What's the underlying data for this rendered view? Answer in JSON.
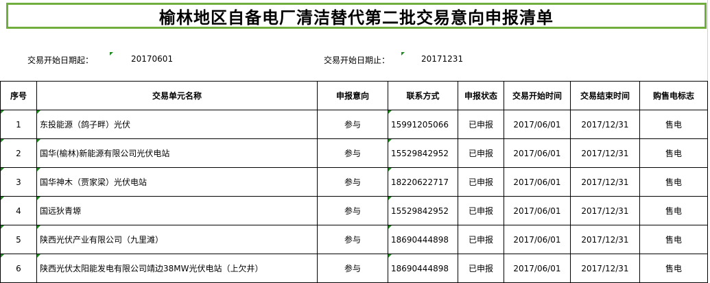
{
  "title": "榆林地区自备电厂清洁替代第二批交易意向申报清单",
  "meta": {
    "start_label": "交易开始日期起：",
    "start_value": "20170601",
    "end_label": "交易开始日期止：",
    "end_value": "20171231"
  },
  "table": {
    "headers": [
      "序号",
      "交易单元名称",
      "申报意向",
      "联系方式",
      "申报状态",
      "交易开始时间",
      "交易结束时间",
      "购售电标志"
    ],
    "rows": [
      {
        "no": "1",
        "name": "东投能源（鸽子畔）光伏",
        "intent": "参与",
        "phone": "15991205066",
        "status": "已申报",
        "start": "2017/06/01",
        "end": "2017/12/31",
        "flag": "售电"
      },
      {
        "no": "2",
        "name": "国华(榆林)新能源有限公司光伏电站",
        "intent": "参与",
        "phone": "15529842952",
        "status": "已申报",
        "start": "2017/06/01",
        "end": "2017/12/31",
        "flag": "售电"
      },
      {
        "no": "3",
        "name": "国华神木（贾家梁）光伏电站",
        "intent": "参与",
        "phone": "18220622717",
        "status": "已申报",
        "start": "2017/06/01",
        "end": "2017/12/31",
        "flag": "售电"
      },
      {
        "no": "4",
        "name": "国远狄青塬",
        "intent": "参与",
        "phone": "15529842952",
        "status": "已申报",
        "start": "2017/06/01",
        "end": "2017/12/31",
        "flag": "售电"
      },
      {
        "no": "5",
        "name": "陕西光伏产业有限公司（九里滩）",
        "intent": "参与",
        "phone": "18690444898",
        "status": "已申报",
        "start": "2017/06/01",
        "end": "2017/12/31",
        "flag": "售电"
      },
      {
        "no": "6",
        "name": "陕西光伏太阳能发电有限公司靖边38MW光伏电站（上欠井）",
        "intent": "参与",
        "phone": "18690444898",
        "status": "已申报",
        "start": "2017/06/01",
        "end": "2017/12/31",
        "flag": "售电"
      }
    ]
  }
}
